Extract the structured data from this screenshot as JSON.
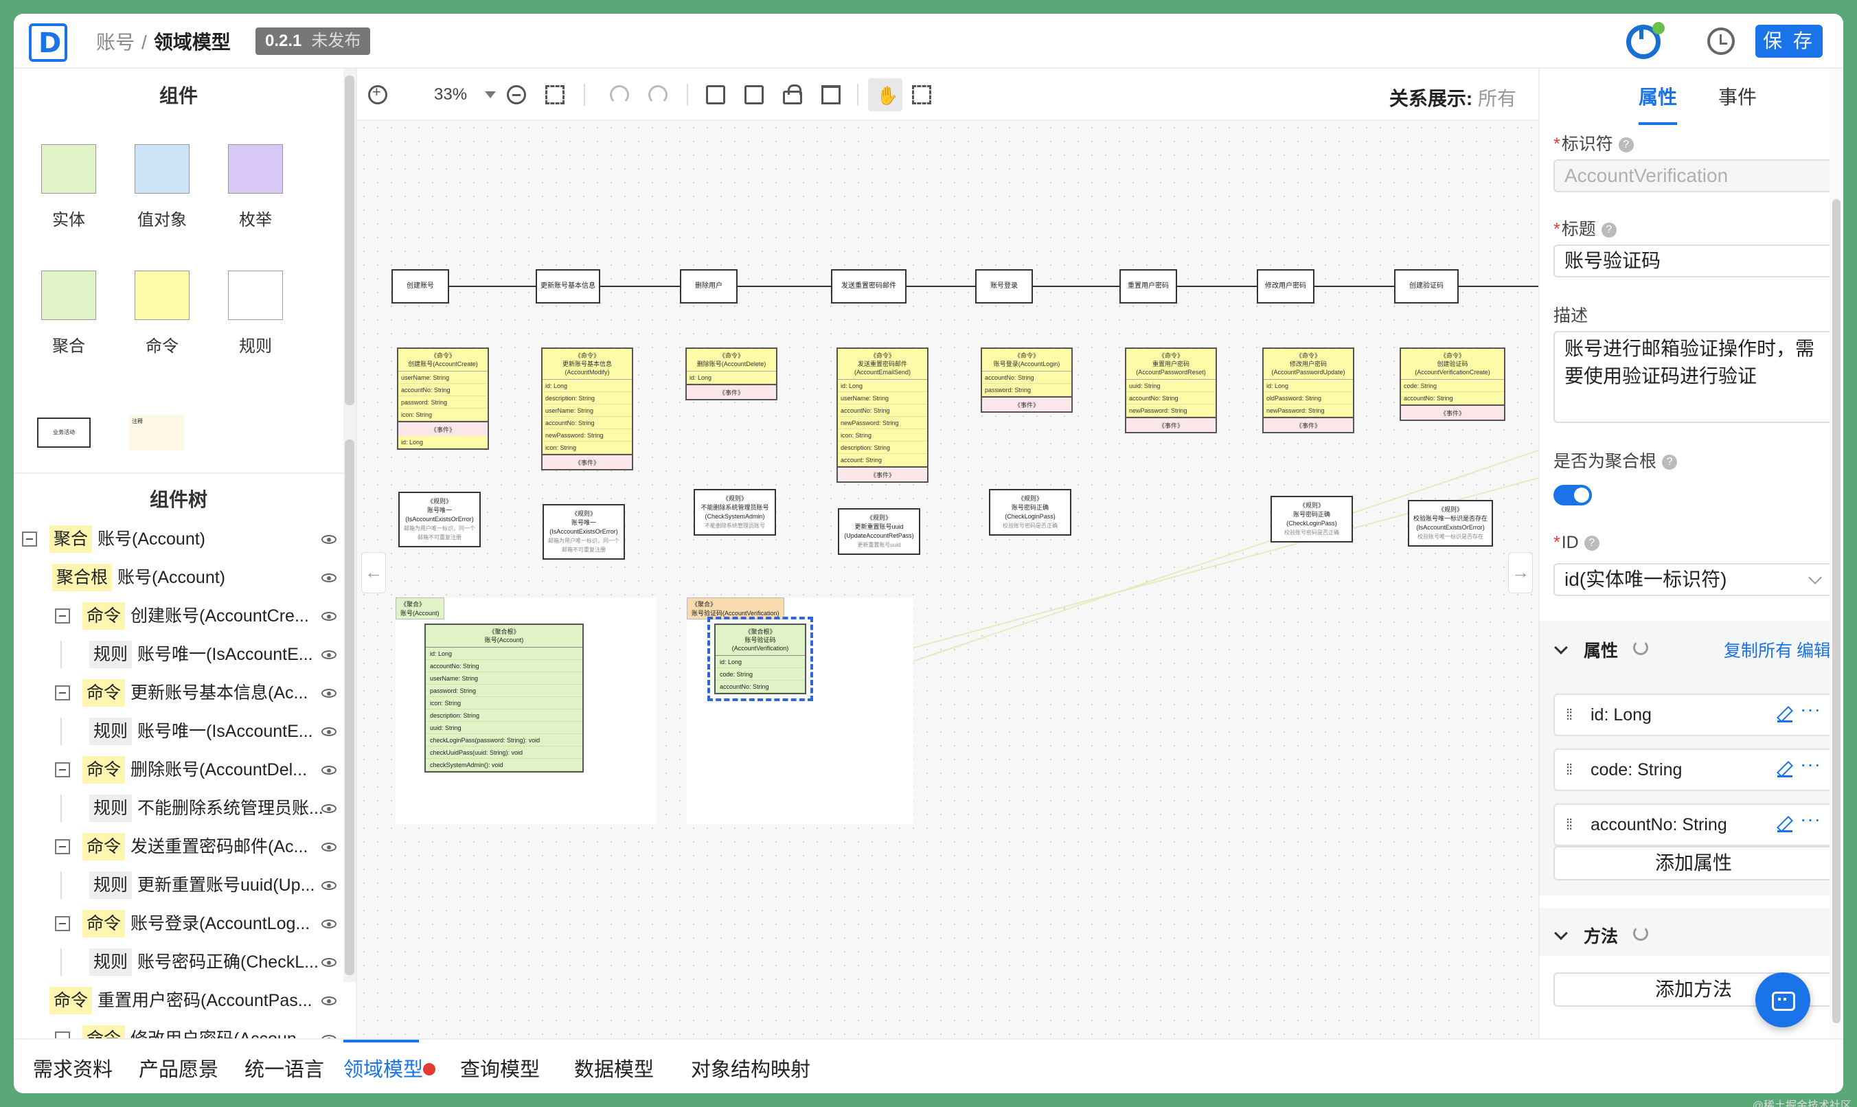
{
  "header": {
    "breadcrumb_root": "账号",
    "breadcrumb_sep": "/",
    "breadcrumb_current": "领域模型",
    "version": "0.2.1",
    "version_status": "未发布",
    "save_label": "保 存"
  },
  "left": {
    "components_title": "组件",
    "components": [
      {
        "label": "实体",
        "icon": "entity-icon",
        "color": "#dff3c6"
      },
      {
        "label": "值对象",
        "icon": "value-object-icon",
        "color": "#cde3f7"
      },
      {
        "label": "枚举",
        "icon": "enum-icon",
        "color": "#d7c8f5"
      },
      {
        "label": "聚合",
        "icon": "aggregate-icon",
        "color": "#dff3c6"
      },
      {
        "label": "命令",
        "icon": "command-icon",
        "color": "#fdfaa8"
      },
      {
        "label": "规则",
        "icon": "rule-icon",
        "color": "#ffffff"
      }
    ],
    "extra_components": [
      {
        "label": "业务活动"
      },
      {
        "label": "注释"
      }
    ],
    "tree_title": "组件树",
    "tree": [
      {
        "tag": "聚合",
        "text": "账号(Account)"
      },
      {
        "tag": "聚合根",
        "text": "账号(Account)"
      },
      {
        "tag": "命令",
        "text": "创建账号(AccountCre..."
      },
      {
        "tag": "规则",
        "text": "账号唯一(IsAccountE..."
      },
      {
        "tag": "命令",
        "text": "更新账号基本信息(Ac..."
      },
      {
        "tag": "规则",
        "text": "账号唯一(IsAccountE..."
      },
      {
        "tag": "命令",
        "text": "删除账号(AccountDel..."
      },
      {
        "tag": "规则",
        "text": "不能删除系统管理员账..."
      },
      {
        "tag": "命令",
        "text": "发送重置密码邮件(Ac..."
      },
      {
        "tag": "规则",
        "text": "更新重置账号uuid(Up..."
      },
      {
        "tag": "命令",
        "text": "账号登录(AccountLog..."
      },
      {
        "tag": "规则",
        "text": "账号密码正确(CheckL..."
      },
      {
        "tag": "命令",
        "text": "重置用户密码(AccountPas..."
      },
      {
        "tag": "命令",
        "text": "修改用户密码(Accoun..."
      }
    ]
  },
  "toolbar": {
    "zoom": "33%",
    "relation_label": "关系展示:",
    "relation_value": "所有"
  },
  "canvas": {
    "events": [
      "创建账号",
      "更新账号基本信息",
      "删除用户",
      "发送重置密码邮件",
      "账号登录",
      "重置用户密码",
      "修改用户密码",
      "创建验证码"
    ],
    "commands": [
      {
        "stereo": "《命令》",
        "title": "创建账号(AccountCreate)",
        "rows": [
          "userName: String",
          "accountNo: String",
          "password: String",
          "icon: String"
        ],
        "event": "《事件》",
        "after": [
          "id: Long"
        ]
      },
      {
        "stereo": "《命令》",
        "title": "更新账号基本信息(AccountModify)",
        "rows": [
          "id: Long",
          "description: String",
          "userName: String",
          "accountNo: String",
          "newPassword: String",
          "icon: String"
        ],
        "event": "《事件》",
        "after": []
      },
      {
        "stereo": "《命令》",
        "title": "删除账号(AccountDelete)",
        "rows": [
          "id: Long"
        ],
        "event": "《事件》",
        "after": []
      },
      {
        "stereo": "《命令》",
        "title": "发送重置密码邮件(AccountEmailSend)",
        "rows": [
          "id: Long",
          "userName: String",
          "accountNo: String",
          "newPassword: String",
          "icon: String",
          "description: String",
          "account: String"
        ],
        "event": "《事件》",
        "after": []
      },
      {
        "stereo": "《命令》",
        "title": "账号登录(AccountLogin)",
        "rows": [
          "accountNo: String",
          "password: String"
        ],
        "event": "《事件》",
        "after": []
      },
      {
        "stereo": "《命令》",
        "title": "重置用户密码(AccountPasswordReset)",
        "rows": [
          "uuid: String",
          "accountNo: String",
          "newPassword: String"
        ],
        "event": "《事件》",
        "after": []
      },
      {
        "stereo": "《命令》",
        "title": "修改用户密码(AccountPasswordUpdate)",
        "rows": [
          "id: Long",
          "oldPassword: String",
          "newPassword: String"
        ],
        "event": "《事件》",
        "after": []
      },
      {
        "stereo": "《命令》",
        "title": "创建验证码(AccountVerificationCreate)",
        "rows": [
          "code: String",
          "accountNo: String"
        ],
        "event": "《事件》",
        "after": []
      }
    ],
    "rules": [
      {
        "stereo": "《规则》",
        "title": "账号唯一",
        "code": "(IsAccountExistsOrError)",
        "note": "邮箱为用户唯一标识，同一个邮箱不可重复注册"
      },
      {
        "stereo": "《规则》",
        "title": "账号唯一",
        "code": "(IsAccountExistsOrError)",
        "note": "邮箱为用户唯一标识，同一个邮箱不可重复注册"
      },
      {
        "stereo": "《规则》",
        "title": "不能删除系统管理员账号",
        "code": "(CheckSystemAdmin)",
        "note": "不能删除系统管理员账号"
      },
      {
        "stereo": "《规则》",
        "title": "更新重置账号uuid",
        "code": "(UpdateAccountRetPass)",
        "note": "更新重置账号uuid"
      },
      {
        "stereo": "《规则》",
        "title": "账号密码正确",
        "code": "(CheckLoginPass)",
        "note": "校验账号密码是否正确"
      },
      {
        "stereo": "《规则》",
        "title": "账号密码正确",
        "code": "(CheckLoginPass)",
        "note": "校验账号密码是否正确"
      },
      {
        "stereo": "《规则》",
        "title": "校验账号唯一标识是否存在",
        "code": "(IsAccountExistsOrError)",
        "note": "校验账号唯一标识是否存在"
      }
    ],
    "aggregates": [
      {
        "label": "《聚合》\n账号(Account)",
        "entity_stereo": "《聚合根》",
        "entity_title": "账号(Account)",
        "rows": [
          "id: Long",
          "accountNo: String",
          "userName: String",
          "password: String",
          "icon: String",
          "description: String",
          "uuid: String",
          "checkLoginPass(password: String): void",
          "checkUuidPass(uuid: String): void",
          "checkSystemAdmin(): void"
        ]
      },
      {
        "label": "《聚合》\n账号验证码(AccountVerification)",
        "entity_stereo": "《聚合根》",
        "entity_title": "账号验证码(AccountVerification)",
        "rows": [
          "id: Long",
          "code: String",
          "accountNo: String"
        ]
      }
    ]
  },
  "right": {
    "tab_props": "属性",
    "tab_events": "事件",
    "identifier_label": "标识符",
    "identifier_value": "AccountVerification",
    "title_label": "标题",
    "title_value": "账号验证码",
    "desc_label": "描述",
    "desc_value": "账号进行邮箱验证操作时，需要使用验证码进行验证",
    "is_root_label": "是否为聚合根",
    "is_root": true,
    "id_label": "ID",
    "id_value": "id(实体唯一标识符)",
    "props_section": "属性",
    "copy_all": "复制所有",
    "edit": "编辑",
    "properties": [
      "id: Long",
      "code: String",
      "accountNo: String"
    ],
    "add_prop": "添加属性",
    "methods_section": "方法",
    "add_method": "添加方法",
    "accent": "#1a73e8"
  },
  "bottom_tabs": [
    "需求资料",
    "产品愿景",
    "统一语言",
    "领域模型",
    "查询模型",
    "数据模型",
    "对象结构映射"
  ],
  "active_tab": "领域模型",
  "watermark": "@稀土掘金技术社区"
}
